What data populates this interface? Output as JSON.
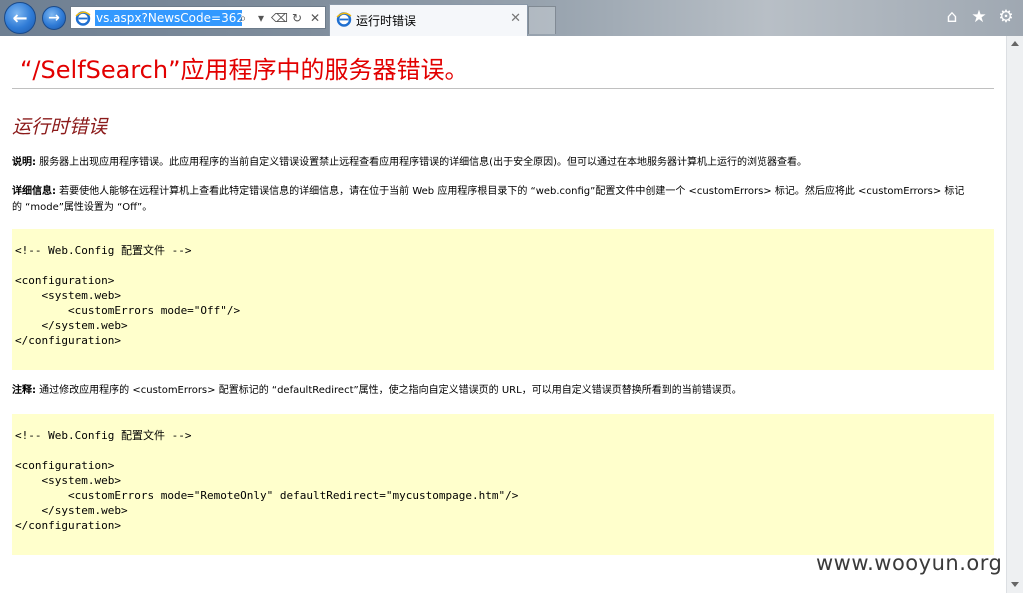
{
  "browser": {
    "back_label": "←",
    "forward_label": "→",
    "address_text": "vs.aspx?NewsCode=362",
    "address_tools": [
      "⌕",
      "▾",
      "⌫",
      "↻",
      "✕"
    ],
    "tab_title": "运行时错误",
    "tab_close": "✕",
    "toolbar_icons": [
      "⌂",
      "★",
      "⚙"
    ]
  },
  "page": {
    "title": "“/SelfSearch”应用程序中的服务器错误。",
    "subtitle": "运行时错误",
    "desc_label": "说明:",
    "desc_text": " 服务器上出现应用程序错误。此应用程序的当前自定义错误设置禁止远程查看应用程序错误的详细信息(出于安全原因)。但可以通过在本地服务器计算机上运行的浏览器查看。",
    "details_label": "详细信息:",
    "details_text": " 若要使他人能够在远程计算机上查看此特定错误信息的详细信息，请在位于当前 Web 应用程序根目录下的 “web.config”配置文件中创建一个 <customErrors> 标记。然后应将此 <customErrors> 标记的 “mode”属性设置为 “Off”。",
    "code1": "<!-- Web.Config 配置文件 -->\n\n<configuration>\n    <system.web>\n        <customErrors mode=\"Off\"/>\n    </system.web>\n</configuration>",
    "notes_label": "注释:",
    "notes_text": " 通过修改应用程序的 <customErrors> 配置标记的 “defaultRedirect”属性，使之指向自定义错误页的 URL，可以用自定义错误页替换所看到的当前错误页。",
    "code2": "<!-- Web.Config 配置文件 -->\n\n<configuration>\n    <system.web>\n        <customErrors mode=\"RemoteOnly\" defaultRedirect=\"mycustompage.htm\"/>\n    </system.web>\n</configuration>"
  },
  "watermark": "www.wooyun.org",
  "colors": {
    "title_red": "#e20000",
    "subtitle_maroon": "#8b1a1a",
    "code_bg": "#ffffcc",
    "selection_blue": "#3399ff"
  }
}
